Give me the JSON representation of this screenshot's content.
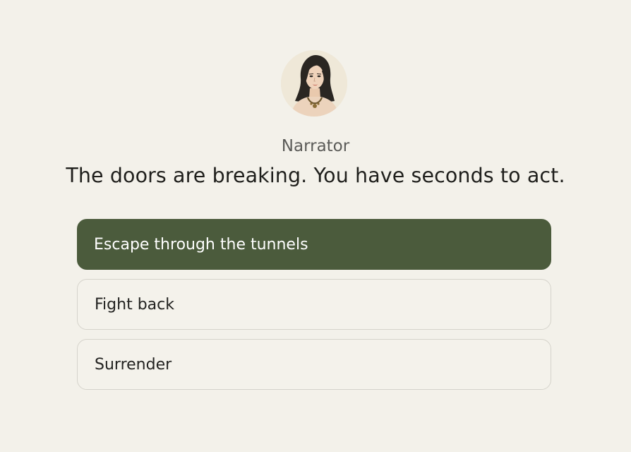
{
  "speaker": {
    "name": "Narrator",
    "avatar_icon": "narrator-portrait-icon"
  },
  "dialogue": {
    "text": "The doors are breaking. You have seconds to act."
  },
  "choices": [
    {
      "label": "Escape through the tunnels",
      "selected": true
    },
    {
      "label": "Fight back",
      "selected": false
    },
    {
      "label": "Surrender",
      "selected": false
    }
  ],
  "colors": {
    "background": "#f3f1ea",
    "selected_choice": "#4b5b3c",
    "choice_border": "#d5d3cb"
  }
}
